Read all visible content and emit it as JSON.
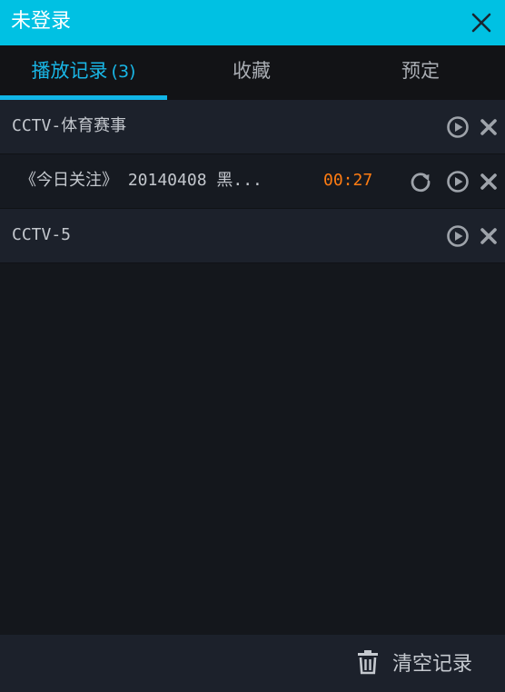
{
  "window": {
    "title": "未登录"
  },
  "tabs": [
    {
      "label": "播放记录",
      "count": "(3)",
      "active": true
    },
    {
      "label": "收藏"
    },
    {
      "label": "预定"
    }
  ],
  "list": {
    "rows": [
      {
        "type": "channel",
        "label": "CCTV-体育赛事"
      },
      {
        "type": "program",
        "label": "《今日关注》 20140408 黑...",
        "time": "00:27"
      },
      {
        "type": "channel",
        "label": "CCTV-5"
      }
    ]
  },
  "footer": {
    "clear_label": "清空记录"
  },
  "colors": {
    "titlebar": "#00c1e3",
    "accent": "#11b5e6",
    "time": "#ff7c12"
  },
  "icons": [
    "close-icon",
    "play-icon",
    "delete-icon",
    "replay-icon",
    "trash-icon"
  ]
}
